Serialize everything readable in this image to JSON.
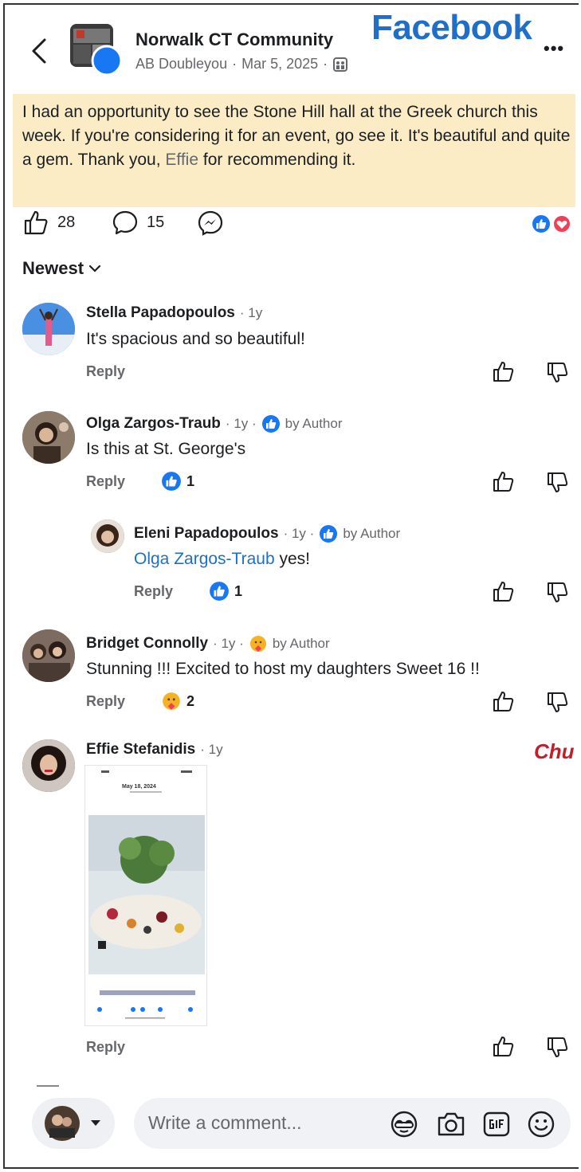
{
  "header": {
    "back_icon": "chevron-left-icon",
    "group_name": "Norwalk CT Community",
    "author": "AB Doubleyou",
    "separator": "·",
    "date": "Mar 5, 2025",
    "audience_icon": "group-members-icon",
    "brand_label": "Facebook",
    "more_label": "•••",
    "brand_color": "#1f6fc8"
  },
  "post": {
    "text_before": "I had an opportunity to see the Stone Hill hall at the Greek church this week. If you're considering it for an event, go see it. It's beautiful and quite a gem. Thank you, ",
    "mention": "Effie",
    "text_after": " for recommending it.",
    "highlight_color": "#fbecc6"
  },
  "actions": {
    "like_count": "28",
    "comment_count": "15",
    "messenger_icon": "messenger-icon",
    "reaction_icons": [
      "like-reaction-icon",
      "love-reaction-icon"
    ]
  },
  "sort": {
    "label": "Newest"
  },
  "comments": [
    {
      "name": "Stella Papadopoulos",
      "age": "1y",
      "text": "It's spacious and so beautiful!",
      "reply_label": "Reply"
    },
    {
      "name": "Olga Zargos-Traub",
      "age": "1y",
      "badge": "by Author",
      "text": "Is this at St. George's",
      "reply_label": "Reply",
      "reaction_count": "1"
    },
    {
      "name": "Eleni Papadopoulos",
      "age": "1y",
      "badge": "by Author",
      "mention": "Olga Zargos-Traub",
      "text": " yes!",
      "reply_label": "Reply",
      "reaction_count": "1"
    },
    {
      "name": "Bridget Connolly",
      "age": "1y",
      "badge": "by Author",
      "text": "Stunning !!! Excited to host my daughters Sweet 16 !!",
      "reply_label": "Reply",
      "reaction_count": "2"
    },
    {
      "name": "Effie Stefanidis",
      "age": "1y",
      "reply_label": "Reply",
      "screenshot_date": "May 18, 2024"
    }
  ],
  "annotation": {
    "text": "Chu",
    "color": "#c41e2a"
  },
  "composer": {
    "placeholder": "Write a comment...",
    "icons": [
      "avatar-sticker-icon",
      "camera-icon",
      "gif-icon",
      "emoji-icon"
    ]
  }
}
